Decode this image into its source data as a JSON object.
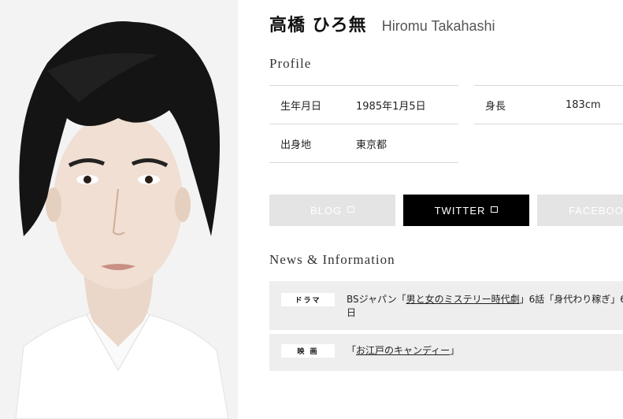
{
  "header": {
    "name_ja": "高橋 ひろ無",
    "name_en": "Hiromu Takahashi"
  },
  "profile": {
    "title": "Profile",
    "rows": [
      {
        "label": "生年月日",
        "value": "1985年1月5日"
      },
      {
        "label": "身長",
        "value": "183cm"
      },
      {
        "label": "出身地",
        "value": "東京都"
      }
    ]
  },
  "links": [
    {
      "label": "BLOG"
    },
    {
      "label": "TWITTER"
    },
    {
      "label": "FACEBOO"
    }
  ],
  "news": {
    "title": "News & Information",
    "items": [
      {
        "category": "ドラマ",
        "pre": "BSジャパン「",
        "link": "男と女のミステリー時代劇",
        "post": "」6話「身代わり稼ぎ」6",
        "line2": "日"
      },
      {
        "category": "映 画",
        "pre": "「",
        "link": "お江戸のキャンディー",
        "post": "」"
      }
    ]
  },
  "colors": {
    "button_gray": "#e4e4e4",
    "button_active": "#000000",
    "news_bg": "#eeeeee"
  }
}
